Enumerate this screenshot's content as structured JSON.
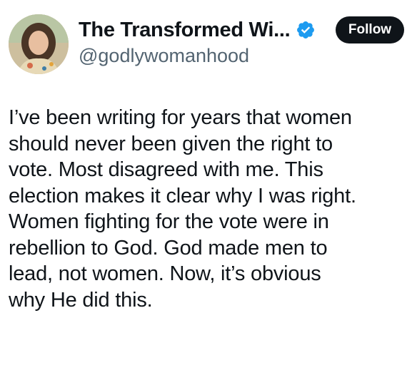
{
  "author": {
    "display_name": "The Transformed Wi...",
    "handle": "@godlywomanhood",
    "verified": true,
    "verified_color": "#1d9bf0"
  },
  "follow_button": {
    "label": "Follow"
  },
  "post": {
    "lines": [
      "I’ve been writing for years that women",
      "should never been given the right to",
      "vote. Most disagreed with me. This",
      "election makes it clear why I was right.",
      "Women fighting for the vote were in",
      "rebellion to God. God made men to",
      "lead, not women. Now, it’s obvious",
      "why He did this."
    ]
  }
}
